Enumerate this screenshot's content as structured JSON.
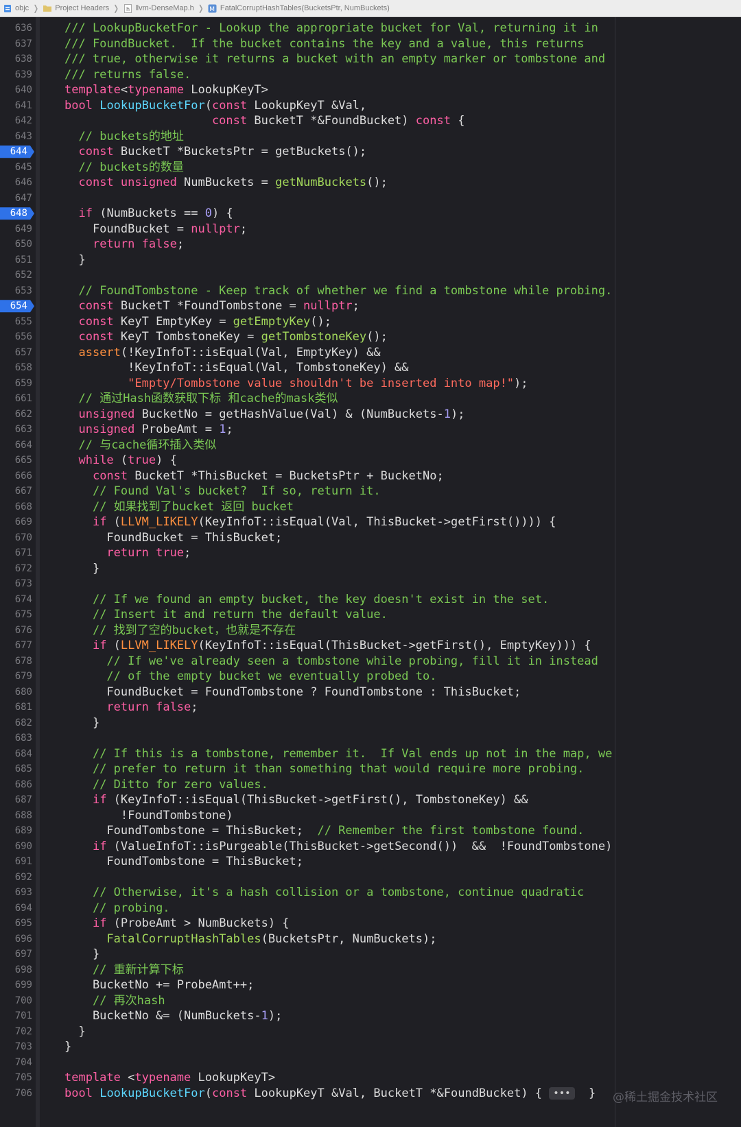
{
  "breadcrumb": {
    "items": [
      {
        "label": "objc",
        "icon": "project-icon"
      },
      {
        "label": "Project Headers",
        "icon": "folder-icon"
      },
      {
        "label": "llvm-DenseMap.h",
        "icon": "header-file-icon"
      },
      {
        "label": "FatalCorruptHashTables(BucketsPtr, NumBuckets)",
        "icon": "method-icon"
      }
    ]
  },
  "breakpoints": [
    644,
    648,
    654
  ],
  "lines": [
    {
      "n": "636",
      "t": [
        [
          "cm",
          "/// LookupBucketFor - Lookup the appropriate bucket for Val, returning it in"
        ]
      ]
    },
    {
      "n": "637",
      "t": [
        [
          "cm",
          "/// FoundBucket.  If the bucket contains the key and a value, this returns"
        ]
      ]
    },
    {
      "n": "638",
      "t": [
        [
          "cm",
          "/// true, otherwise it returns a bucket with an empty marker or tombstone and"
        ]
      ]
    },
    {
      "n": "639",
      "t": [
        [
          "cm",
          "/// returns false."
        ]
      ]
    },
    {
      "n": "640",
      "t": [
        [
          "kw",
          "template"
        ],
        [
          "pl",
          "<"
        ],
        [
          "kw",
          "typename"
        ],
        [
          "pl",
          " LookupKeyT>"
        ]
      ]
    },
    {
      "n": "641",
      "t": [
        [
          "kw",
          "bool"
        ],
        [
          "pl",
          " "
        ],
        [
          "fd",
          "LookupBucketFor"
        ],
        [
          "pl",
          "("
        ],
        [
          "kw",
          "const"
        ],
        [
          "pl",
          " LookupKeyT &Val,"
        ]
      ]
    },
    {
      "n": "642",
      "t": [
        [
          "pl",
          "                     "
        ],
        [
          "kw",
          "const"
        ],
        [
          "pl",
          " BucketT *&FoundBucket) "
        ],
        [
          "kw",
          "const"
        ],
        [
          "pl",
          " {"
        ]
      ]
    },
    {
      "n": "643",
      "t": [
        [
          "pl",
          "  "
        ],
        [
          "cm",
          "// buckets的地址"
        ]
      ]
    },
    {
      "n": "644",
      "t": [
        [
          "pl",
          "  "
        ],
        [
          "kw",
          "const"
        ],
        [
          "pl",
          " BucketT *BucketsPtr = getBuckets();"
        ]
      ]
    },
    {
      "n": "645",
      "t": [
        [
          "pl",
          "  "
        ],
        [
          "cm",
          "// buckets的数量"
        ]
      ]
    },
    {
      "n": "646",
      "t": [
        [
          "pl",
          "  "
        ],
        [
          "kw",
          "const"
        ],
        [
          "pl",
          " "
        ],
        [
          "kw",
          "unsigned"
        ],
        [
          "pl",
          " NumBuckets = "
        ],
        [
          "ex",
          "getNumBuckets"
        ],
        [
          "pl",
          "();"
        ]
      ]
    },
    {
      "n": "647",
      "t": []
    },
    {
      "n": "648",
      "t": [
        [
          "pl",
          "  "
        ],
        [
          "kw",
          "if"
        ],
        [
          "pl",
          " (NumBuckets == "
        ],
        [
          "nm",
          "0"
        ],
        [
          "pl",
          ") {"
        ]
      ]
    },
    {
      "n": "649",
      "t": [
        [
          "pl",
          "    FoundBucket = "
        ],
        [
          "kw",
          "nullptr"
        ],
        [
          "pl",
          ";"
        ]
      ]
    },
    {
      "n": "650",
      "t": [
        [
          "pl",
          "    "
        ],
        [
          "kw",
          "return"
        ],
        [
          "pl",
          " "
        ],
        [
          "kw",
          "false"
        ],
        [
          "pl",
          ";"
        ]
      ]
    },
    {
      "n": "651",
      "t": [
        [
          "pl",
          "  }"
        ]
      ]
    },
    {
      "n": "652",
      "t": []
    },
    {
      "n": "653",
      "t": [
        [
          "pl",
          "  "
        ],
        [
          "cm",
          "// FoundTombstone - Keep track of whether we find a tombstone while probing."
        ]
      ]
    },
    {
      "n": "654",
      "t": [
        [
          "pl",
          "  "
        ],
        [
          "kw",
          "const"
        ],
        [
          "pl",
          " BucketT *FoundTombstone = "
        ],
        [
          "kw",
          "nullptr"
        ],
        [
          "pl",
          ";"
        ]
      ]
    },
    {
      "n": "655",
      "t": [
        [
          "pl",
          "  "
        ],
        [
          "kw",
          "const"
        ],
        [
          "pl",
          " KeyT EmptyKey = "
        ],
        [
          "ex",
          "getEmptyKey"
        ],
        [
          "pl",
          "();"
        ]
      ]
    },
    {
      "n": "656",
      "t": [
        [
          "pl",
          "  "
        ],
        [
          "kw",
          "const"
        ],
        [
          "pl",
          " KeyT TombstoneKey = "
        ],
        [
          "ex",
          "getTombstoneKey"
        ],
        [
          "pl",
          "();"
        ]
      ]
    },
    {
      "n": "657",
      "t": [
        [
          "pl",
          "  "
        ],
        [
          "mc",
          "assert"
        ],
        [
          "pl",
          "(!KeyInfoT::isEqual(Val, EmptyKey) &&"
        ]
      ]
    },
    {
      "n": "658",
      "t": [
        [
          "pl",
          "         !KeyInfoT::isEqual(Val, TombstoneKey) &&"
        ]
      ]
    },
    {
      "n": "659",
      "t": [
        [
          "pl",
          "         "
        ],
        [
          "st",
          "\"Empty/Tombstone value shouldn't be inserted into map!\""
        ],
        [
          "pl",
          ");"
        ]
      ]
    },
    {
      "n": "661",
      "t": [
        [
          "pl",
          "  "
        ],
        [
          "cm",
          "// 通过Hash函数获取下标 和cache的mask类似"
        ]
      ]
    },
    {
      "n": "662",
      "t": [
        [
          "pl",
          "  "
        ],
        [
          "kw",
          "unsigned"
        ],
        [
          "pl",
          " BucketNo = getHashValue(Val) & (NumBuckets-"
        ],
        [
          "nm",
          "1"
        ],
        [
          "pl",
          ");"
        ]
      ]
    },
    {
      "n": "663",
      "t": [
        [
          "pl",
          "  "
        ],
        [
          "kw",
          "unsigned"
        ],
        [
          "pl",
          " ProbeAmt = "
        ],
        [
          "nm",
          "1"
        ],
        [
          "pl",
          ";"
        ]
      ]
    },
    {
      "n": "664",
      "t": [
        [
          "pl",
          "  "
        ],
        [
          "cm",
          "// 与cache循环插入类似"
        ]
      ]
    },
    {
      "n": "665",
      "t": [
        [
          "pl",
          "  "
        ],
        [
          "kw",
          "while"
        ],
        [
          "pl",
          " ("
        ],
        [
          "kw",
          "true"
        ],
        [
          "pl",
          ") {"
        ]
      ]
    },
    {
      "n": "666",
      "t": [
        [
          "pl",
          "    "
        ],
        [
          "kw",
          "const"
        ],
        [
          "pl",
          " BucketT *ThisBucket = BucketsPtr + BucketNo;"
        ]
      ]
    },
    {
      "n": "667",
      "t": [
        [
          "pl",
          "    "
        ],
        [
          "cm",
          "// Found Val's bucket?  If so, return it."
        ]
      ]
    },
    {
      "n": "668",
      "t": [
        [
          "pl",
          "    "
        ],
        [
          "cm",
          "// 如果找到了bucket 返回 bucket"
        ]
      ]
    },
    {
      "n": "669",
      "t": [
        [
          "pl",
          "    "
        ],
        [
          "kw",
          "if"
        ],
        [
          "pl",
          " ("
        ],
        [
          "mc",
          "LLVM_LIKELY"
        ],
        [
          "pl",
          "(KeyInfoT::isEqual(Val, ThisBucket->getFirst()))) {"
        ]
      ]
    },
    {
      "n": "670",
      "t": [
        [
          "pl",
          "      FoundBucket = ThisBucket;"
        ]
      ]
    },
    {
      "n": "671",
      "t": [
        [
          "pl",
          "      "
        ],
        [
          "kw",
          "return"
        ],
        [
          "pl",
          " "
        ],
        [
          "kw",
          "true"
        ],
        [
          "pl",
          ";"
        ]
      ]
    },
    {
      "n": "672",
      "t": [
        [
          "pl",
          "    }"
        ]
      ]
    },
    {
      "n": "673",
      "t": []
    },
    {
      "n": "674",
      "t": [
        [
          "pl",
          "    "
        ],
        [
          "cm",
          "// If we found an empty bucket, the key doesn't exist in the set."
        ]
      ]
    },
    {
      "n": "675",
      "t": [
        [
          "pl",
          "    "
        ],
        [
          "cm",
          "// Insert it and return the default value."
        ]
      ]
    },
    {
      "n": "676",
      "t": [
        [
          "pl",
          "    "
        ],
        [
          "cm",
          "// 找到了空的bucket，也就是不存在"
        ]
      ]
    },
    {
      "n": "677",
      "t": [
        [
          "pl",
          "    "
        ],
        [
          "kw",
          "if"
        ],
        [
          "pl",
          " ("
        ],
        [
          "mc",
          "LLVM_LIKELY"
        ],
        [
          "pl",
          "(KeyInfoT::isEqual(ThisBucket->getFirst(), EmptyKey))) {"
        ]
      ]
    },
    {
      "n": "678",
      "t": [
        [
          "pl",
          "      "
        ],
        [
          "cm",
          "// If we've already seen a tombstone while probing, fill it in instead"
        ]
      ]
    },
    {
      "n": "679",
      "t": [
        [
          "pl",
          "      "
        ],
        [
          "cm",
          "// of the empty bucket we eventually probed to."
        ]
      ]
    },
    {
      "n": "680",
      "t": [
        [
          "pl",
          "      FoundBucket = FoundTombstone ? FoundTombstone : ThisBucket;"
        ]
      ]
    },
    {
      "n": "681",
      "t": [
        [
          "pl",
          "      "
        ],
        [
          "kw",
          "return"
        ],
        [
          "pl",
          " "
        ],
        [
          "kw",
          "false"
        ],
        [
          "pl",
          ";"
        ]
      ]
    },
    {
      "n": "682",
      "t": [
        [
          "pl",
          "    }"
        ]
      ]
    },
    {
      "n": "683",
      "t": []
    },
    {
      "n": "684",
      "t": [
        [
          "pl",
          "    "
        ],
        [
          "cm",
          "// If this is a tombstone, remember it.  If Val ends up not in the map, we"
        ]
      ]
    },
    {
      "n": "685",
      "t": [
        [
          "pl",
          "    "
        ],
        [
          "cm",
          "// prefer to return it than something that would require more probing."
        ]
      ]
    },
    {
      "n": "686",
      "t": [
        [
          "pl",
          "    "
        ],
        [
          "cm",
          "// Ditto for zero values."
        ]
      ]
    },
    {
      "n": "687",
      "t": [
        [
          "pl",
          "    "
        ],
        [
          "kw",
          "if"
        ],
        [
          "pl",
          " (KeyInfoT::isEqual(ThisBucket->getFirst(), TombstoneKey) &&"
        ]
      ]
    },
    {
      "n": "688",
      "t": [
        [
          "pl",
          "        !FoundTombstone)"
        ]
      ]
    },
    {
      "n": "689",
      "t": [
        [
          "pl",
          "      FoundTombstone = ThisBucket;  "
        ],
        [
          "cm",
          "// Remember the first tombstone found."
        ]
      ]
    },
    {
      "n": "690",
      "t": [
        [
          "pl",
          "    "
        ],
        [
          "kw",
          "if"
        ],
        [
          "pl",
          " (ValueInfoT::isPurgeable(ThisBucket->getSecond())  &&  !FoundTombstone)"
        ]
      ]
    },
    {
      "n": "691",
      "t": [
        [
          "pl",
          "      FoundTombstone = ThisBucket;"
        ]
      ]
    },
    {
      "n": "692",
      "t": []
    },
    {
      "n": "693",
      "t": [
        [
          "pl",
          "    "
        ],
        [
          "cm",
          "// Otherwise, it's a hash collision or a tombstone, continue quadratic"
        ]
      ]
    },
    {
      "n": "694",
      "t": [
        [
          "pl",
          "    "
        ],
        [
          "cm",
          "// probing."
        ]
      ]
    },
    {
      "n": "695",
      "t": [
        [
          "pl",
          "    "
        ],
        [
          "kw",
          "if"
        ],
        [
          "pl",
          " (ProbeAmt > NumBuckets) {"
        ]
      ]
    },
    {
      "n": "696",
      "t": [
        [
          "pl",
          "      "
        ],
        [
          "ex",
          "FatalCorruptHashTables"
        ],
        [
          "pl",
          "(BucketsPtr, NumBuckets);"
        ]
      ]
    },
    {
      "n": "697",
      "t": [
        [
          "pl",
          "    }"
        ]
      ]
    },
    {
      "n": "698",
      "t": [
        [
          "pl",
          "    "
        ],
        [
          "cm",
          "// 重新计算下标"
        ]
      ]
    },
    {
      "n": "699",
      "t": [
        [
          "pl",
          "    BucketNo += ProbeAmt++;"
        ]
      ]
    },
    {
      "n": "700",
      "t": [
        [
          "pl",
          "    "
        ],
        [
          "cm",
          "// 再次hash"
        ]
      ]
    },
    {
      "n": "701",
      "t": [
        [
          "pl",
          "    BucketNo &= (NumBuckets-"
        ],
        [
          "nm",
          "1"
        ],
        [
          "pl",
          ");"
        ]
      ]
    },
    {
      "n": "702",
      "t": [
        [
          "pl",
          "  }"
        ]
      ]
    },
    {
      "n": "703",
      "t": [
        [
          "pl",
          "}"
        ]
      ]
    },
    {
      "n": "704",
      "t": []
    },
    {
      "n": "705",
      "t": [
        [
          "kw",
          "template"
        ],
        [
          "pl",
          " <"
        ],
        [
          "kw",
          "typename"
        ],
        [
          "pl",
          " LookupKeyT>"
        ]
      ]
    },
    {
      "n": "706",
      "t": [
        [
          "kw",
          "bool"
        ],
        [
          "pl",
          " "
        ],
        [
          "fd",
          "LookupBucketFor"
        ],
        [
          "pl",
          "("
        ],
        [
          "kw",
          "const"
        ],
        [
          "pl",
          " LookupKeyT &Val, BucketT *&FoundBucket) { "
        ],
        [
          "fold",
          "•••"
        ],
        [
          "pl",
          "  }"
        ]
      ]
    }
  ],
  "watermark": "@稀土掘金技术社区"
}
